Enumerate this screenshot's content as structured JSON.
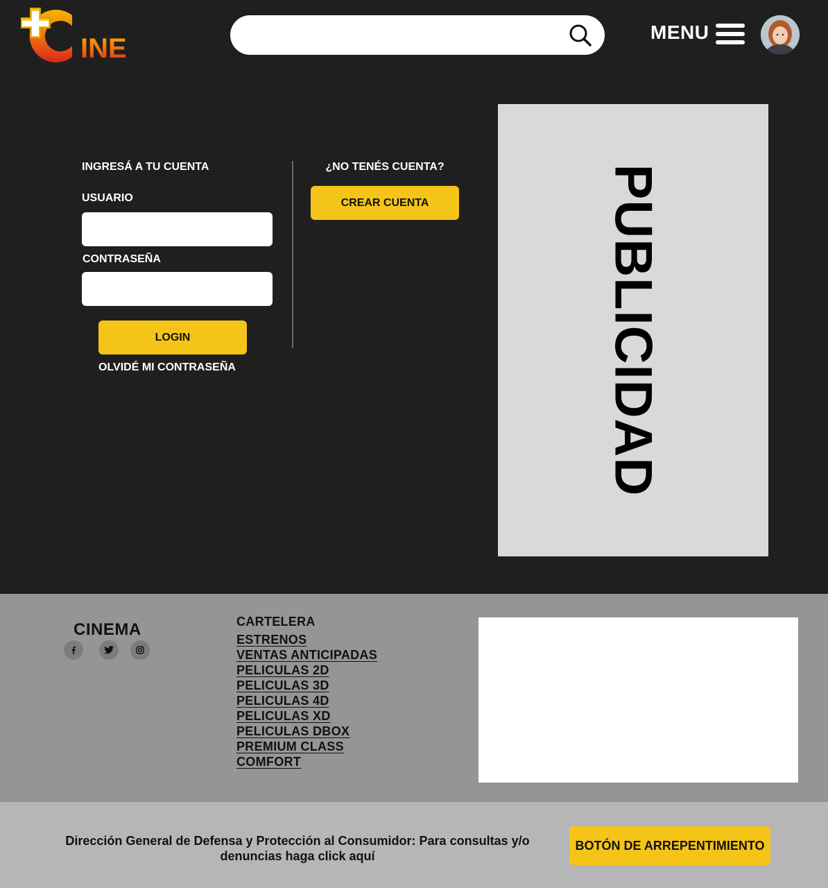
{
  "header": {
    "logo_text": "INE",
    "search": {
      "placeholder": "",
      "value": ""
    },
    "menu_label": "MENU"
  },
  "login": {
    "title": "INGRESÁ A TU CUENTA",
    "username_label": "USUARIO",
    "username_value": "",
    "password_label": "CONTRASEÑA",
    "password_value": "",
    "login_button": "LOGIN",
    "forgot_link": "OLVIDÉ MI CONTRASEÑA"
  },
  "register": {
    "prompt": "¿NO TENÉS CUENTA?",
    "create_button": "CREAR CUENTA"
  },
  "ad": {
    "label": "PUBLICIDAD"
  },
  "footer": {
    "brand": "CINEMA",
    "links_title": "CARTELERA",
    "links": [
      "ESTRENOS",
      "VENTAS ANTICIPADAS",
      "PELICULAS 2D",
      "PELICULAS 3D",
      "PELICULAS 4D",
      "PELICULAS XD",
      "PELICULAS DBOX",
      "PREMIUM CLASS",
      "COMFORT"
    ]
  },
  "bottom": {
    "consumer_line1": "Dirección General de Defensa y Protección al Consumidor: Para consultas y/o",
    "consumer_line2": "denuncias haga click aquí",
    "regret_button": "BOTÓN DE ARREPENTIMIENTO"
  },
  "colors": {
    "background": "#1f1f1f",
    "accent_yellow": "#f4c419",
    "footer_gray": "#959595",
    "bottom_gray": "#b6b6b6",
    "ad_gray": "#d9d9d9"
  },
  "icons": [
    "logo-plus-icon",
    "search-icon",
    "hamburger-icon",
    "facebook-icon",
    "twitter-icon",
    "instagram-icon"
  ]
}
